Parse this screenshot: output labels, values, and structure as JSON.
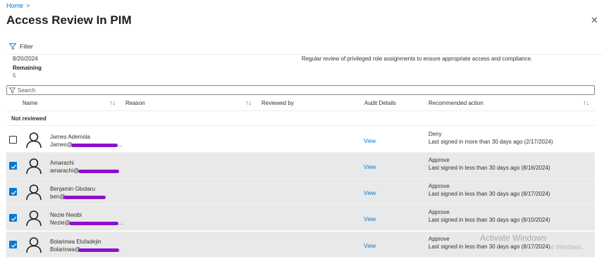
{
  "breadcrumb": {
    "home": "Home",
    "separator": ">"
  },
  "page": {
    "title": "Access Review In PIM",
    "more": "···",
    "close": "✕"
  },
  "toolbar": {
    "filter_label": "Filter"
  },
  "summary": {
    "date": "8/20/2024",
    "remaining_label": "Remaining",
    "remaining_value": "5",
    "description": "Regular review of privileged role assignments to ensure appropriate access and compliance."
  },
  "search": {
    "placeholder": "Search"
  },
  "columns": {
    "name": "Name",
    "reason": "Reason",
    "reviewed_by": "Reviewed by",
    "audit_details": "Audit Details",
    "recommended_action": "Recommended action",
    "sort_glyph": "↑↓"
  },
  "group": {
    "label": "Not reviewed"
  },
  "rows": [
    {
      "name": "James Ademola",
      "email_prefix": "James@",
      "email_suffix": "...",
      "checked": false,
      "audit": "View",
      "action": "Deny",
      "detail": "Last signed in more than 30 days ago (2/17/2024)"
    },
    {
      "name": "Amarachi",
      "email_prefix": "amarachi@",
      "email_suffix": "",
      "checked": true,
      "audit": "View",
      "action": "Approve",
      "detail": "Last signed in less than 30 days ago (8/16/2024)"
    },
    {
      "name": "Benjamin Gbolaru",
      "email_prefix": "ben@",
      "email_suffix": "",
      "checked": true,
      "audit": "View",
      "action": "Approve",
      "detail": "Last signed in less than 30 days ago (8/17/2024)"
    },
    {
      "name": "Nezie Nwobi",
      "email_prefix": "Nezie@",
      "email_suffix": "...",
      "checked": true,
      "audit": "View",
      "action": "Approve",
      "detail": "Last signed in less than 30 days ago (8/10/2024)"
    },
    {
      "name": "Bolarinwa Elufadejin",
      "email_prefix": "Bolarinwa@",
      "email_suffix": ".",
      "checked": true,
      "audit": "View",
      "action": "Approve",
      "detail": "Last signed in less than 30 days ago (8/17/2024)"
    }
  ],
  "watermark": {
    "line1": "Activate Windows",
    "line2": "e Windows."
  },
  "colors": {
    "accent": "#0078d4",
    "selected_row": "#e9e9e9",
    "redaction": "#8d11c9"
  }
}
